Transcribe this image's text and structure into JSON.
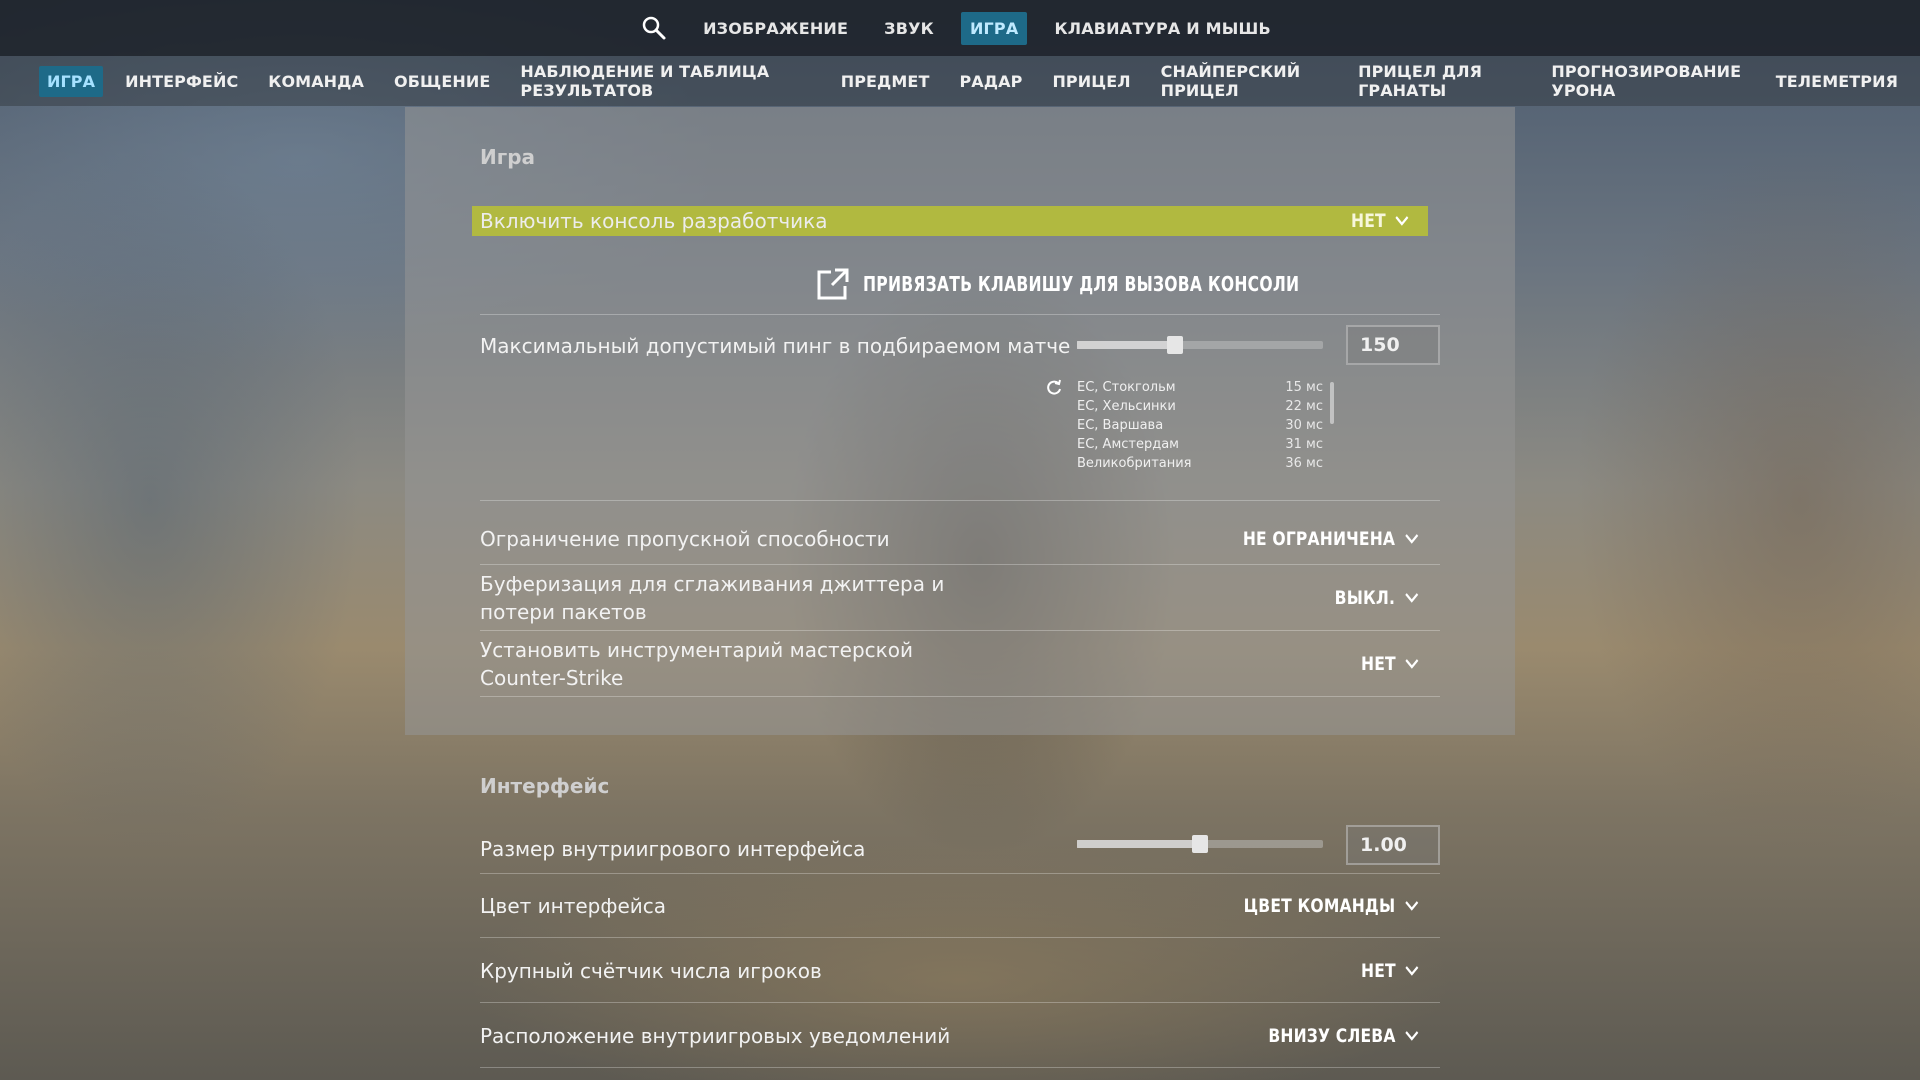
{
  "top_nav": {
    "tabs": [
      {
        "label": "ИЗОБРАЖЕНИЕ",
        "active": false
      },
      {
        "label": "ЗВУК",
        "active": false
      },
      {
        "label": "ИГРА",
        "active": true
      },
      {
        "label": "КЛАВИАТУРА И МЫШЬ",
        "active": false
      }
    ]
  },
  "sub_nav": {
    "tabs": [
      {
        "label": "ИГРА",
        "active": true
      },
      {
        "label": "ИНТЕРФЕЙС",
        "active": false
      },
      {
        "label": "КОМАНДА",
        "active": false
      },
      {
        "label": "ОБЩЕНИЕ",
        "active": false
      },
      {
        "label": "НАБЛЮДЕНИЕ И ТАБЛИЦА РЕЗУЛЬТАТОВ",
        "active": false
      },
      {
        "label": "ПРЕДМЕТ",
        "active": false
      },
      {
        "label": "РАДАР",
        "active": false
      },
      {
        "label": "ПРИЦЕЛ",
        "active": false
      },
      {
        "label": "СНАЙПЕРСКИЙ ПРИЦЕЛ",
        "active": false
      },
      {
        "label": "ПРИЦЕЛ ДЛЯ ГРАНАТЫ",
        "active": false
      },
      {
        "label": "ПРОГНОЗИРОВАНИЕ УРОНА",
        "active": false
      },
      {
        "label": "ТЕЛЕМЕТРИЯ",
        "active": false
      }
    ]
  },
  "game_section": {
    "title": "Игра",
    "dev_console": {
      "label": "Включить консоль разработчика",
      "value": "НЕТ"
    },
    "bind_console": {
      "label": "ПРИВЯЗАТЬ КЛАВИШУ ДЛЯ ВЫЗОВА КОНСОЛИ"
    },
    "max_ping": {
      "label": "Максимальный допустимый пинг в подбираемом матче",
      "value": "150",
      "slider_fraction": 0.4
    },
    "servers": [
      {
        "name": "ЕС, Стокгольм",
        "ping": "15 мс"
      },
      {
        "name": "ЕС, Хельсинки",
        "ping": "22 мс"
      },
      {
        "name": "ЕС, Варшава",
        "ping": "30 мс"
      },
      {
        "name": "ЕС, Амстердам",
        "ping": "31 мс"
      },
      {
        "name": "Великобритания",
        "ping": "36 мс"
      }
    ],
    "bandwidth": {
      "label": "Ограничение пропускной способности",
      "value": "НЕ ОГРАНИЧЕНА"
    },
    "jitter": {
      "label_line1": "Буферизация для сглаживания джиттера и",
      "label_line2": "потери пакетов",
      "value": "ВЫКЛ."
    },
    "workshop": {
      "label_line1": "Установить инструментарий мастерской",
      "label_line2": "Counter-Strike",
      "value": "НЕТ"
    }
  },
  "interface_section": {
    "title": "Интерфейс",
    "hud_scale": {
      "label": "Размер внутриигрового интерфейса",
      "value": "1.00",
      "slider_fraction": 0.5
    },
    "hud_color": {
      "label": "Цвет интерфейса",
      "value": "ЦВЕТ КОМАНДЫ"
    },
    "player_count": {
      "label": "Крупный счётчик числа игроков",
      "value": "НЕТ"
    },
    "notifications": {
      "label": "Расположение внутриигровых уведомлений",
      "value": "ВНИЗУ СЛЕВА"
    }
  },
  "colors": {
    "accent": "#1e6a88",
    "highlight": "#bcc430"
  }
}
